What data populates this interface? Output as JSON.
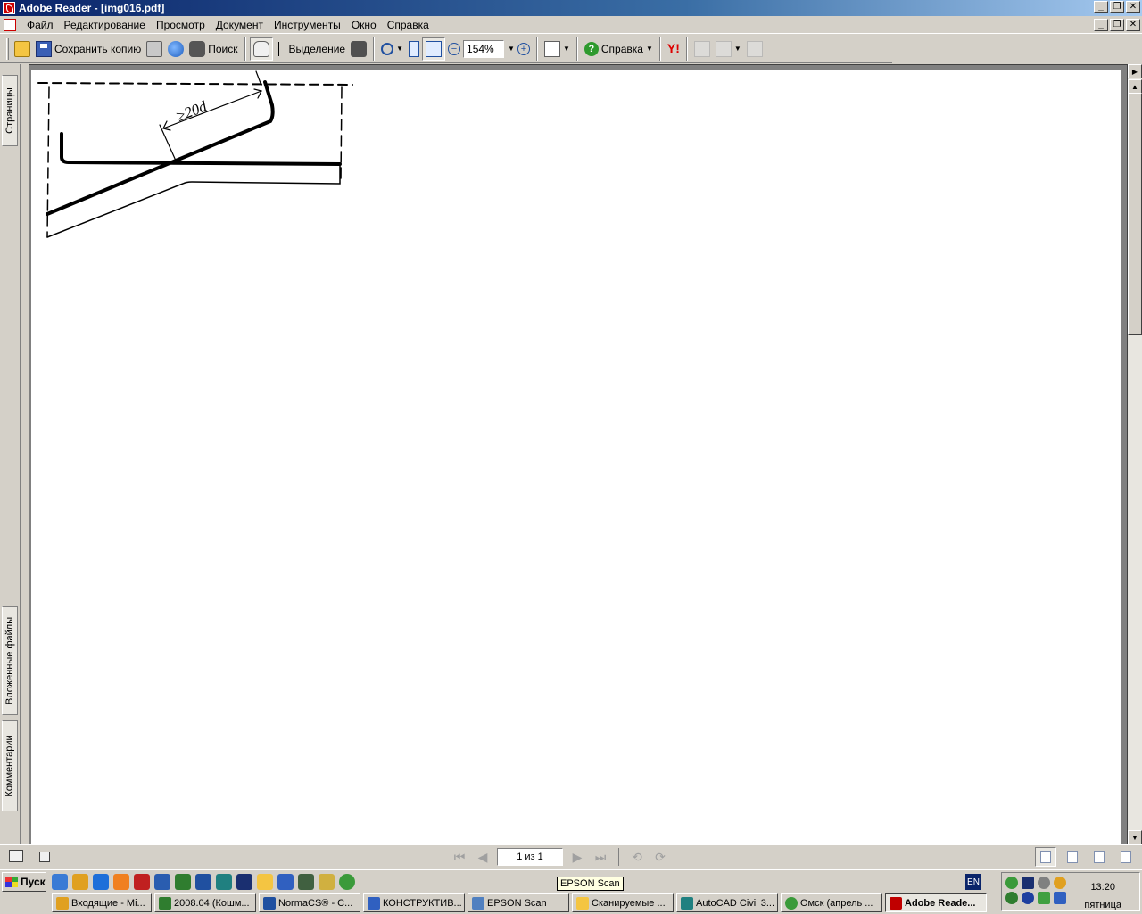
{
  "window": {
    "title": "Adobe Reader - [img016.pdf]"
  },
  "menu": [
    "Файл",
    "Редактирование",
    "Просмотр",
    "Документ",
    "Инструменты",
    "Окно",
    "Справка"
  ],
  "toolbar": {
    "save_copy_label": "Сохранить копию",
    "search_label": "Поиск",
    "select_label": "Выделение",
    "zoom_value": "154%",
    "help_label": "Справка"
  },
  "side_tabs": {
    "pages": "Страницы",
    "attachments": "Вложенные файлы",
    "comments": "Комментарии"
  },
  "document": {
    "annotation": "≥20d"
  },
  "status": {
    "page_indicator": "1 из 1"
  },
  "taskbar": {
    "start_label": "Пуск",
    "language": "EN",
    "tooltip": "EPSON Scan",
    "tasks": [
      {
        "label": "Входящие - Mi...",
        "icon_color": "#e0a020"
      },
      {
        "label": "2008.04 (Кошм...",
        "icon_color": "#2f7d2f"
      },
      {
        "label": "NormaCS® - С...",
        "icon_color": "#2050a0"
      },
      {
        "label": "КОНСТРУКТИВ...",
        "icon_color": "#3060c0"
      },
      {
        "label": "EPSON Scan",
        "icon_color": "#5080c0"
      },
      {
        "label": "Сканируемые ...",
        "icon_color": "#f4c542"
      },
      {
        "label": "AutoCAD Civil 3...",
        "icon_color": "#208080"
      },
      {
        "label": "Омск (апрель ...",
        "icon_color": "#3a9a3a"
      },
      {
        "label": "Adobe Reade...",
        "icon_color": "#c00000"
      }
    ],
    "clock_time": "13:20",
    "clock_day": "пятница"
  },
  "colors": {
    "titlebar": "#0a246a",
    "chrome": "#d4d0c8",
    "page": "#ffffff"
  }
}
